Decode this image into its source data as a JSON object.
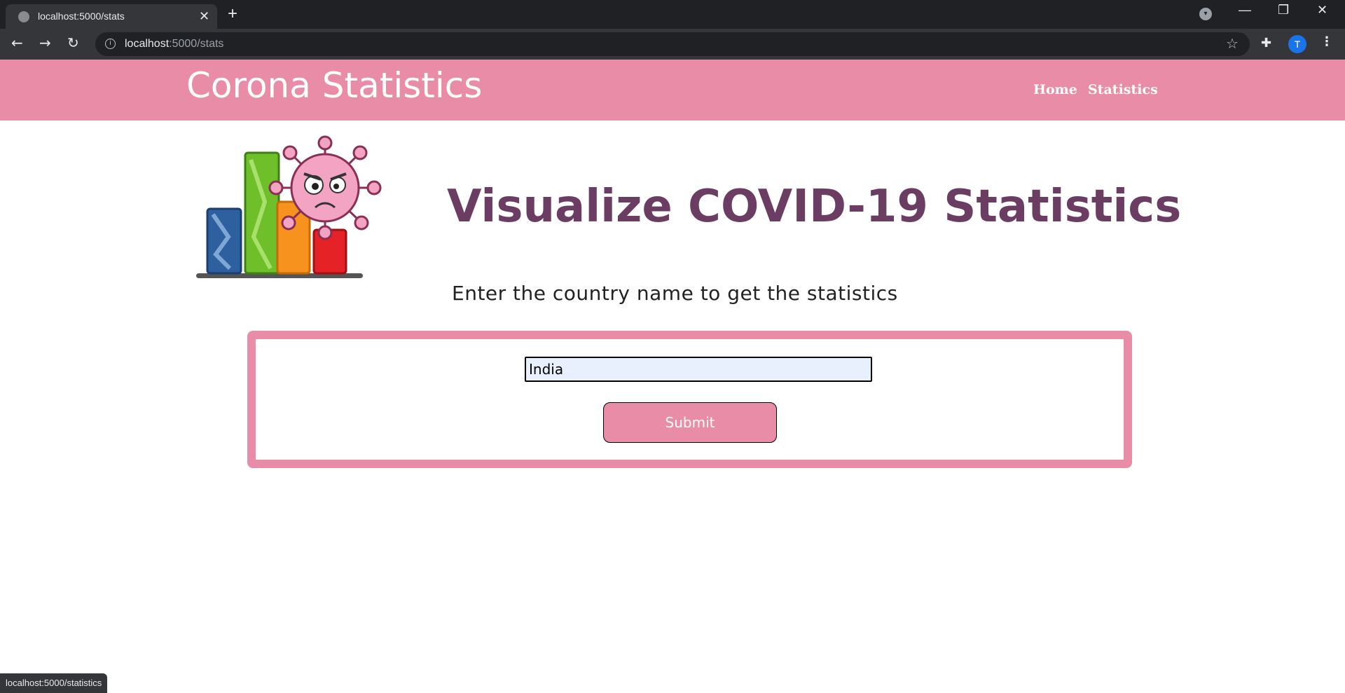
{
  "browser": {
    "tab_title": "localhost:5000/stats",
    "url_host": "localhost",
    "url_rest": ":5000/stats",
    "profile_initial": "T",
    "status_url": "localhost:5000/statistics"
  },
  "site": {
    "brand": "Corona Statistics",
    "nav": [
      {
        "label": "Home"
      },
      {
        "label": "Statistics"
      }
    ]
  },
  "hero": {
    "title": "Visualize COVID-19 Statistics",
    "subtitle": "Enter the country name to get the statistics"
  },
  "form": {
    "country_value": "India",
    "submit_label": "Submit"
  },
  "colors": {
    "brand_pink": "#e98ca8",
    "title_purple": "#6b3d63"
  },
  "icons": [
    "globe-icon",
    "close-icon",
    "plus-icon",
    "back-icon",
    "forward-icon",
    "reload-icon",
    "info-icon",
    "star-icon",
    "puzzle-icon",
    "kebab-menu-icon",
    "chart-virus-logo"
  ]
}
